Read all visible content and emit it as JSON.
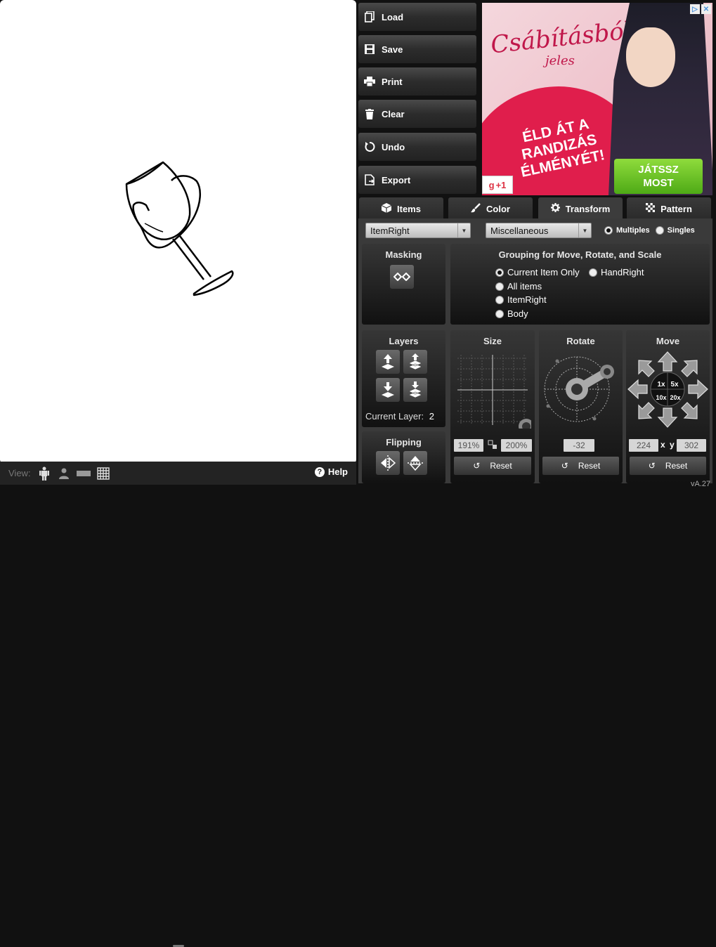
{
  "toolbar": {
    "load": "Load",
    "save": "Save",
    "print": "Print",
    "clear": "Clear",
    "undo": "Undo",
    "export": "Export"
  },
  "ad": {
    "brand": "Csábításból",
    "brand_sub": "jeles",
    "slogan": "ÉLD ÁT A RANDIZÁS ÉLMÉNYÉT!",
    "cta_line1": "JÁTSSZ",
    "cta_line2": "MOST",
    "gplus": "+1"
  },
  "tabs": [
    {
      "label": "Items",
      "icon": "cube-icon"
    },
    {
      "label": "Color",
      "icon": "brush-icon"
    },
    {
      "label": "Transform",
      "icon": "gear-icon",
      "active": true
    },
    {
      "label": "Pattern",
      "icon": "checker-icon"
    }
  ],
  "selects": {
    "item": "ItemRight",
    "category": "Miscellaneous"
  },
  "mode": {
    "multiples": "Multiples",
    "singles": "Singles",
    "selected": "Multiples"
  },
  "masking": {
    "title": "Masking"
  },
  "grouping": {
    "title": "Grouping for Move, Rotate, and Scale",
    "options": [
      "Current Item Only",
      "HandRight",
      "All items",
      "ItemRight",
      "Body"
    ],
    "selected": "Current Item Only"
  },
  "layers": {
    "title": "Layers",
    "current_label": "Current Layer:",
    "current_value": "2"
  },
  "flipping": {
    "title": "Flipping"
  },
  "size": {
    "title": "Size",
    "width": "191",
    "height": "200",
    "unit": "%",
    "reset": "Reset"
  },
  "rotate": {
    "title": "Rotate",
    "value": "-32",
    "reset": "Reset"
  },
  "move": {
    "title": "Move",
    "steps": [
      "1x",
      "5x",
      "10x",
      "20x"
    ],
    "x": "224",
    "sep": "x",
    "y_label": "y",
    "y": "302",
    "reset": "Reset"
  },
  "viewbar": {
    "label": "View:",
    "help": "Help"
  },
  "version": "vA.27",
  "colors": {
    "accent_green": "#6cc42a",
    "ad_red": "#e01e4c",
    "panel_bg": "#3a3a3a"
  }
}
